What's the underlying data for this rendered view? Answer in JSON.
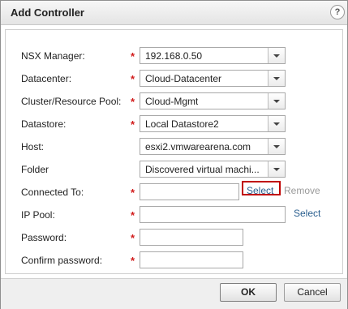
{
  "dialog": {
    "title": "Add Controller",
    "help_glyph": "?"
  },
  "form": {
    "required_mark": "*",
    "nsx_manager": {
      "label": "NSX Manager:",
      "value": "192.168.0.50"
    },
    "datacenter": {
      "label": "Datacenter:",
      "value": "Cloud-Datacenter"
    },
    "cluster": {
      "label": "Cluster/Resource Pool:",
      "value": "Cloud-Mgmt"
    },
    "datastore": {
      "label": "Datastore:",
      "value": "Local Datastore2"
    },
    "host": {
      "label": "Host:",
      "value": "esxi2.vmwarearena.com"
    },
    "folder": {
      "label": "Folder",
      "value": "Discovered virtual machi..."
    },
    "connected_to": {
      "label": "Connected To:",
      "value": "",
      "select_label": "Select",
      "remove_label": "Remove"
    },
    "ip_pool": {
      "label": "IP Pool:",
      "value": "",
      "select_label": "Select"
    },
    "password": {
      "label": "Password:",
      "value": ""
    },
    "confirm_password": {
      "label": "Confirm password:",
      "value": ""
    }
  },
  "footer": {
    "ok_label": "OK",
    "cancel_label": "Cancel"
  },
  "icons": {
    "dropdown": "chevron-down-icon",
    "help": "help-icon"
  }
}
